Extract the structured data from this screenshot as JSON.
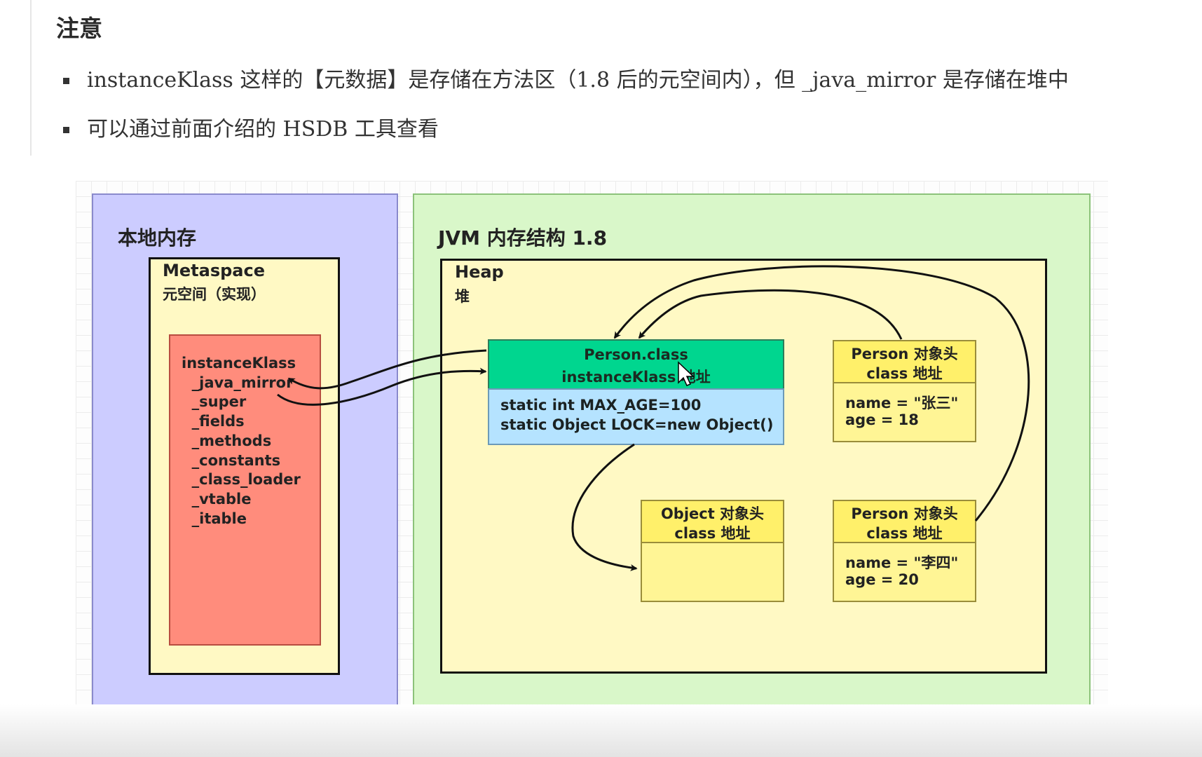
{
  "heading": "注意",
  "bullets": [
    "instanceKlass 这样的【元数据】是存储在方法区（1.8 后的元空间内），但 _java_mirror 是存储在堆中",
    "可以通过前面介绍的 HSDB 工具查看"
  ],
  "diagram": {
    "native_memory": {
      "title": "本地内存"
    },
    "metaspace": {
      "title": "Metaspace",
      "subtitle": "元空间（实现）",
      "instance_klass": {
        "fields": [
          "instanceKlass",
          "  _java_mirror",
          "  _super",
          "  _fields",
          "  _methods",
          "  _constants",
          "  _class_loader",
          "  _vtable",
          "  _itable"
        ]
      }
    },
    "jvm": {
      "title": "JVM 内存结构 1.8"
    },
    "heap": {
      "title": "Heap",
      "subtitle": "堆"
    },
    "person_class": {
      "line1": "Person.class",
      "line2": "instanceKlass 地址",
      "static1": "static int  MAX_AGE=100",
      "static2": "static Object LOCK=new Object()"
    },
    "person_obj_1": {
      "header1": "Person 对象头",
      "header2": "class 地址",
      "name": "name = \"张三\"",
      "age": "age = 18"
    },
    "object_obj": {
      "header1": "Object 对象头",
      "header2": "class 地址"
    },
    "person_obj_2": {
      "header1": "Person 对象头",
      "header2": "class 地址",
      "name": "name = \"李四\"",
      "age": "age = 20"
    }
  }
}
